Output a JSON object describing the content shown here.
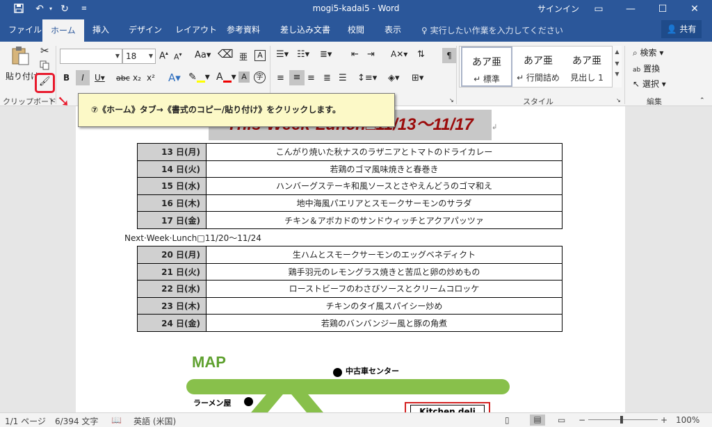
{
  "titlebar": {
    "title": "mogi5-kadai5  -  Word",
    "signin": "サインイン",
    "save_icon": "save-icon",
    "undo_icon": "undo-icon",
    "redo_icon": "redo-icon"
  },
  "tabs": {
    "file": "ファイル",
    "home": "ホーム",
    "insert": "挿入",
    "design": "デザイン",
    "layout": "レイアウト",
    "references": "参考資料",
    "mailings": "差し込み文書",
    "review": "校閲",
    "view": "表示",
    "tellme": "実行したい作業を入力してください",
    "share": "共有"
  },
  "ribbon": {
    "paste": "貼り付け",
    "clipboard_label": "クリップボード",
    "font_name": "",
    "font_size": "18",
    "styles_label": "スタイル",
    "edit_label": "編集",
    "find": "検索",
    "replace": "置換",
    "select": "選択",
    "styles": [
      {
        "preview": "あア亜",
        "name": "↵ 標準"
      },
      {
        "preview": "あア亜",
        "name": "↵ 行間詰め"
      },
      {
        "preview": "あア亜",
        "name": "見出し 1"
      }
    ]
  },
  "callout": "⑦《ホーム》タブ→《書式のコピー/貼り付け》をクリックします。",
  "document": {
    "headline": "This·Week·Lunch□11/13～11/17",
    "week1": [
      {
        "day": "13 日(月)",
        "dish": "こんがり焼いた秋ナスのラザニアとトマトのドライカレー"
      },
      {
        "day": "14 日(火)",
        "dish": "若鶏のゴマ風味焼きと春巻き"
      },
      {
        "day": "15 日(水)",
        "dish": "ハンバーグステーキ和風ソースとさやえんどうのゴマ和え"
      },
      {
        "day": "16 日(木)",
        "dish": "地中海風パエリアとスモークサーモンのサラダ"
      },
      {
        "day": "17 日(金)",
        "dish": "チキン＆アボカドのサンドウィッチとアクアパッツァ"
      }
    ],
    "nextweek": "Next·Week·Lunch□11/20～11/24",
    "week2": [
      {
        "day": "20 日(月)",
        "dish": "生ハムとスモークサーモンのエッグベネディクト"
      },
      {
        "day": "21 日(火)",
        "dish": "鶏手羽元のレモングラス焼きと苦瓜と卵の炒めもの"
      },
      {
        "day": "22 日(水)",
        "dish": "ローストビーフのわさびソースとクリームコロッケ"
      },
      {
        "day": "23 日(木)",
        "dish": "チキンのタイ風スパイシー炒め"
      },
      {
        "day": "24 日(金)",
        "dish": "若鶏のバンバンジー風と豚の角煮"
      }
    ],
    "map": {
      "title": "MAP",
      "used_car": "中古車センター",
      "ramen": "ラーメン屋",
      "kitchen": "Kitchen deli"
    }
  },
  "statusbar": {
    "page": "1/1 ページ",
    "words": "6/394 文字",
    "lang": "英語 (米国)",
    "zoom": "100%"
  },
  "colors": {
    "brand": "#2b579a",
    "headline": "#9b0b0b",
    "road": "#88c04b",
    "callout_bg": "#fcf9c7",
    "highlight": "#e8192c"
  }
}
